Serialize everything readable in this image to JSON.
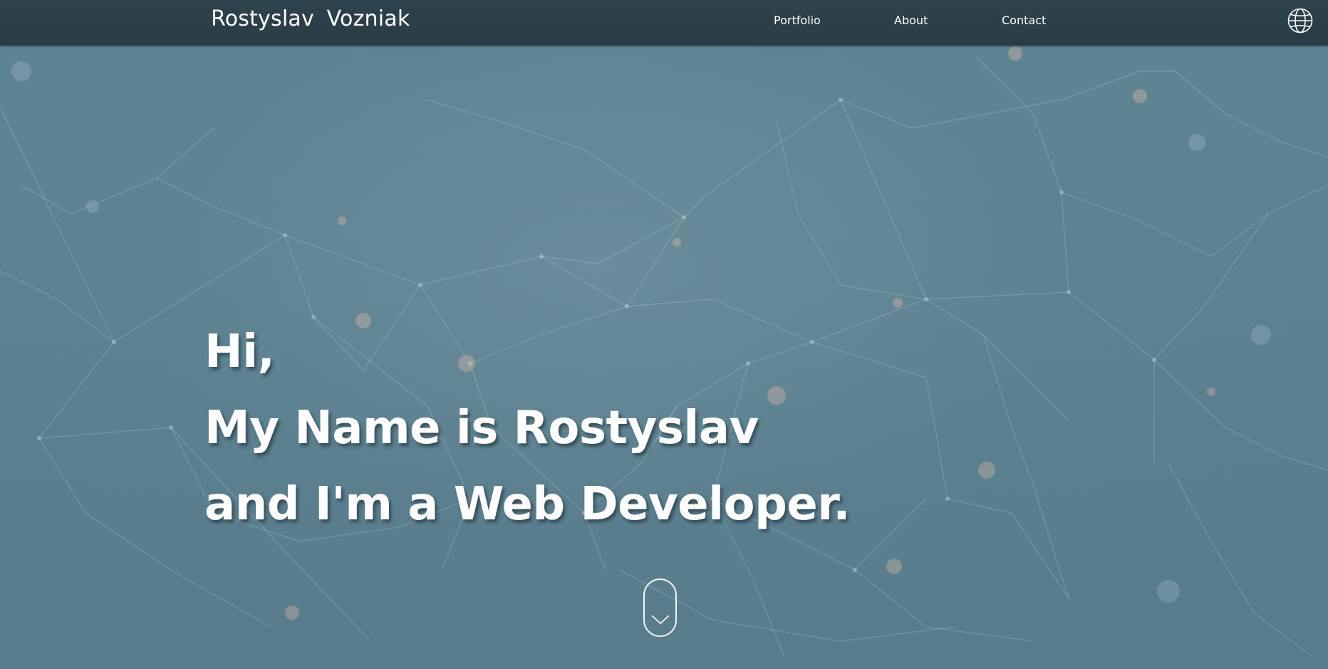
{
  "navbar": {
    "brand": "Rostyslav  Vozniak",
    "links": [
      {
        "label": "Portfolio"
      },
      {
        "label": "About"
      },
      {
        "label": "Contact"
      }
    ],
    "language_icon": "globe-icon"
  },
  "hero": {
    "lines": [
      "Hi,",
      "My Name is Rostyslav",
      "and I'm a Web Developer."
    ],
    "scroll_icon": "chevron-down-icon"
  },
  "colors": {
    "navbar_bg": "#2b3d45",
    "hero_bg": "#5c8291",
    "text": "#ffffff"
  }
}
